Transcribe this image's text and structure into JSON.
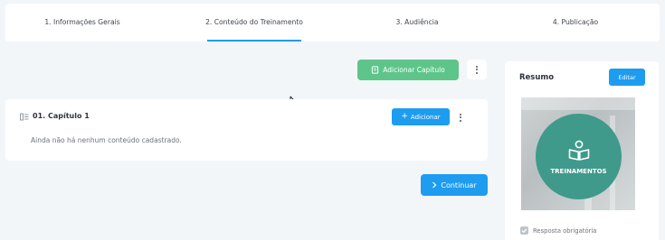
{
  "stepper": {
    "steps": [
      {
        "label": "1. Informações Gerais"
      },
      {
        "label": "2. Conteúdo do Treinamento",
        "active": true
      },
      {
        "label": "3. Audiência"
      },
      {
        "label": "4. Publicação"
      }
    ]
  },
  "toolbar": {
    "add_chapter_label": "Adicionar Capítulo",
    "add_chapter_color": "#5ec58a"
  },
  "chapter": {
    "title": "01. Capítulo 1",
    "add_label": "Adicionar",
    "empty_text": "Ainda não há nenhum conteúdo cadastrado."
  },
  "footer": {
    "continue_label": "Continuar"
  },
  "summary": {
    "title": "Resumo",
    "edit_label": "Editar",
    "thumbnail_text": "TREINAMENTOS",
    "thumbnail_color": "#3f9a8b",
    "required_answer_label": "Resposta obrigatória",
    "required_answer_checked": true
  },
  "colors": {
    "accent": "#1e9cf0",
    "background": "#f3f6f9"
  }
}
